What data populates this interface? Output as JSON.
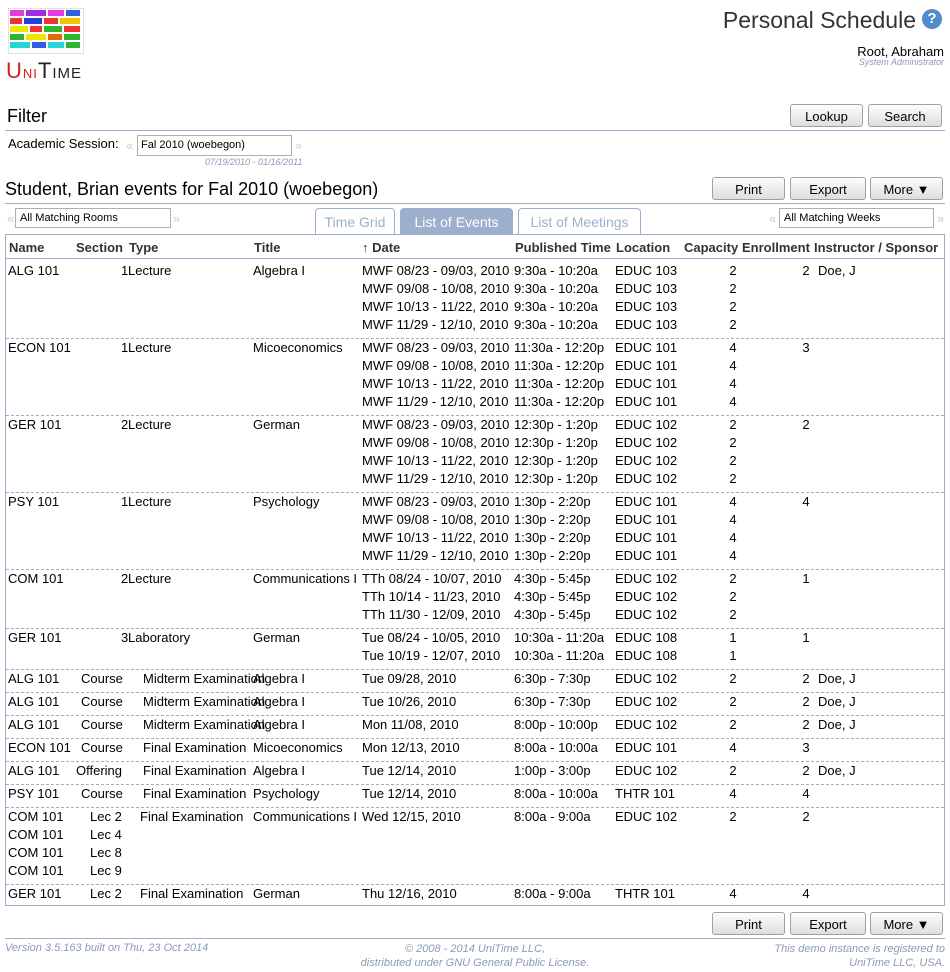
{
  "header": {
    "logo_text_u": "U",
    "logo_text_ni": "NI",
    "logo_text_t": "T",
    "logo_text_ime": "IME",
    "title": "Personal Schedule",
    "help_icon": "question-mark-icon",
    "user_name": "Root, Abraham",
    "user_role": "System Administrator"
  },
  "filter": {
    "heading": "Filter",
    "lookup_label": "Lookup",
    "search_label": "Search",
    "session_label": "Academic Session:",
    "session_value": "Fal 2010 (woebegon)",
    "session_dates": "07/19/2010 - 01/16/2011",
    "prev_arrow": "«",
    "next_arrow": "»"
  },
  "events": {
    "heading": "Student, Brian events for Fal 2010 (woebegon)",
    "print_label": "Print",
    "export_label": "Export",
    "more_label": "More ▼",
    "rooms_filter": "All Matching Rooms",
    "weeks_filter": "All Matching Weeks",
    "tabs": [
      "Time Grid",
      "List of Events",
      "List of Meetings"
    ],
    "columns": [
      "Name",
      "Section",
      "Type",
      "Title",
      "↑ Date",
      "Published Time",
      "Location",
      "Capacity",
      "Enrollment",
      "Instructor / Sponsor"
    ]
  },
  "groups": [
    {
      "name": [
        "ALG 101"
      ],
      "section": [
        "1"
      ],
      "type": "Lecture",
      "title": "Algebra I",
      "dates": [
        "MWF 08/23 - 09/03, 2010",
        "MWF 09/08 - 10/08, 2010",
        "MWF 10/13 - 11/22, 2010",
        "MWF 11/29 - 12/10, 2010"
      ],
      "times": [
        "9:30a - 10:20a",
        "9:30a - 10:20a",
        "9:30a - 10:20a",
        "9:30a - 10:20a"
      ],
      "locations": [
        "EDUC 103",
        "EDUC 103",
        "EDUC 103",
        "EDUC 103"
      ],
      "capacity": [
        "2",
        "2",
        "2",
        "2"
      ],
      "enrollment": "2",
      "instructor": "Doe, J"
    },
    {
      "name": [
        "ECON 101"
      ],
      "section": [
        "1"
      ],
      "type": "Lecture",
      "title": "Micoeconomics",
      "dates": [
        "MWF 08/23 - 09/03, 2010",
        "MWF 09/08 - 10/08, 2010",
        "MWF 10/13 - 11/22, 2010",
        "MWF 11/29 - 12/10, 2010"
      ],
      "times": [
        "11:30a - 12:20p",
        "11:30a - 12:20p",
        "11:30a - 12:20p",
        "11:30a - 12:20p"
      ],
      "locations": [
        "EDUC 101",
        "EDUC 101",
        "EDUC 101",
        "EDUC 101"
      ],
      "capacity": [
        "4",
        "4",
        "4",
        "4"
      ],
      "enrollment": "3",
      "instructor": ""
    },
    {
      "name": [
        "GER 101"
      ],
      "section": [
        "2"
      ],
      "type": "Lecture",
      "title": "German",
      "dates": [
        "MWF 08/23 - 09/03, 2010",
        "MWF 09/08 - 10/08, 2010",
        "MWF 10/13 - 11/22, 2010",
        "MWF 11/29 - 12/10, 2010"
      ],
      "times": [
        "12:30p - 1:20p",
        "12:30p - 1:20p",
        "12:30p - 1:20p",
        "12:30p - 1:20p"
      ],
      "locations": [
        "EDUC 102",
        "EDUC 102",
        "EDUC 102",
        "EDUC 102"
      ],
      "capacity": [
        "2",
        "2",
        "2",
        "2"
      ],
      "enrollment": "2",
      "instructor": ""
    },
    {
      "name": [
        "PSY 101"
      ],
      "section": [
        "1"
      ],
      "type": "Lecture",
      "title": "Psychology",
      "dates": [
        "MWF 08/23 - 09/03, 2010",
        "MWF 09/08 - 10/08, 2010",
        "MWF 10/13 - 11/22, 2010",
        "MWF 11/29 - 12/10, 2010"
      ],
      "times": [
        "1:30p - 2:20p",
        "1:30p - 2:20p",
        "1:30p - 2:20p",
        "1:30p - 2:20p"
      ],
      "locations": [
        "EDUC 101",
        "EDUC 101",
        "EDUC 101",
        "EDUC 101"
      ],
      "capacity": [
        "4",
        "4",
        "4",
        "4"
      ],
      "enrollment": "4",
      "instructor": ""
    },
    {
      "name": [
        "COM 101"
      ],
      "section": [
        "2"
      ],
      "type": "Lecture",
      "title": "Communications I",
      "dates": [
        "TTh 08/24 - 10/07, 2010",
        "TTh 10/14 - 11/23, 2010",
        "TTh 11/30 - 12/09, 2010"
      ],
      "times": [
        "4:30p - 5:45p",
        "4:30p - 5:45p",
        "4:30p - 5:45p"
      ],
      "locations": [
        "EDUC 102",
        "EDUC 102",
        "EDUC 102"
      ],
      "capacity": [
        "2",
        "2",
        "2"
      ],
      "enrollment": "1",
      "instructor": ""
    },
    {
      "name": [
        "GER 101"
      ],
      "section": [
        "3"
      ],
      "type": "Laboratory",
      "title": "German",
      "dates": [
        "Tue 08/24 - 10/05, 2010",
        "Tue 10/19 - 12/07, 2010"
      ],
      "times": [
        "10:30a - 11:20a",
        "10:30a - 11:20a"
      ],
      "locations": [
        "EDUC 108",
        "EDUC 108"
      ],
      "capacity": [
        "1",
        "1"
      ],
      "enrollment": "1",
      "instructor": ""
    },
    {
      "name": [
        "ALG 101"
      ],
      "section": [
        "Course"
      ],
      "type": "Midterm Examination",
      "title": "Algebra I",
      "dates": [
        "Tue 09/28, 2010"
      ],
      "times": [
        "6:30p - 7:30p"
      ],
      "locations": [
        "EDUC 102"
      ],
      "capacity": [
        "2"
      ],
      "enrollment": "2",
      "instructor": "Doe, J"
    },
    {
      "name": [
        "ALG 101"
      ],
      "section": [
        "Course"
      ],
      "type": "Midterm Examination",
      "title": "Algebra I",
      "dates": [
        "Tue 10/26, 2010"
      ],
      "times": [
        "6:30p - 7:30p"
      ],
      "locations": [
        "EDUC 102"
      ],
      "capacity": [
        "2"
      ],
      "enrollment": "2",
      "instructor": "Doe, J"
    },
    {
      "name": [
        "ALG 101"
      ],
      "section": [
        "Course"
      ],
      "type": "Midterm Examination",
      "title": "Algebra I",
      "dates": [
        "Mon 11/08, 2010"
      ],
      "times": [
        "8:00p - 10:00p"
      ],
      "locations": [
        "EDUC 102"
      ],
      "capacity": [
        "2"
      ],
      "enrollment": "2",
      "instructor": "Doe, J"
    },
    {
      "name": [
        "ECON 101"
      ],
      "section": [
        "Course"
      ],
      "type": "Final Examination",
      "title": "Micoeconomics",
      "dates": [
        "Mon 12/13, 2010"
      ],
      "times": [
        "8:00a - 10:00a"
      ],
      "locations": [
        "EDUC 101"
      ],
      "capacity": [
        "4"
      ],
      "enrollment": "3",
      "instructor": ""
    },
    {
      "name": [
        "ALG 101"
      ],
      "section": [
        "Offering"
      ],
      "type": "Final Examination",
      "title": "Algebra I",
      "dates": [
        "Tue 12/14, 2010"
      ],
      "times": [
        "1:00p - 3:00p"
      ],
      "locations": [
        "EDUC 102"
      ],
      "capacity": [
        "2"
      ],
      "enrollment": "2",
      "instructor": "Doe, J"
    },
    {
      "name": [
        "PSY 101"
      ],
      "section": [
        "Course"
      ],
      "type": "Final Examination",
      "title": "Psychology",
      "dates": [
        "Tue 12/14, 2010"
      ],
      "times": [
        "8:00a - 10:00a"
      ],
      "locations": [
        "THTR 101"
      ],
      "capacity": [
        "4"
      ],
      "enrollment": "4",
      "instructor": ""
    },
    {
      "name": [
        "COM 101",
        "COM 101",
        "COM 101",
        "COM 101"
      ],
      "section": [
        "Lec 2",
        "Lec 4",
        "Lec 8",
        "Lec 9"
      ],
      "type": "Final Examination",
      "title": "Communications I",
      "dates": [
        "Wed 12/15, 2010"
      ],
      "times": [
        "8:00a - 9:00a"
      ],
      "locations": [
        "EDUC 102"
      ],
      "capacity": [
        "2"
      ],
      "enrollment": "2",
      "instructor": ""
    },
    {
      "name": [
        "GER 101"
      ],
      "section": [
        "Lec 2"
      ],
      "type": "Final Examination",
      "title": "German",
      "dates": [
        "Thu 12/16, 2010"
      ],
      "times": [
        "8:00a - 9:00a"
      ],
      "locations": [
        "THTR 101"
      ],
      "capacity": [
        "4"
      ],
      "enrollment": "4",
      "instructor": ""
    }
  ],
  "footer": {
    "version": "Version 3.5.163 built on Thu, 23 Oct 2014",
    "copyright_1": "© 2008 - 2014 UniTime LLC,",
    "copyright_2": "distributed under GNU General Public License.",
    "registered_1": "This demo instance is registered to",
    "registered_2": "UniTime LLC, USA."
  }
}
